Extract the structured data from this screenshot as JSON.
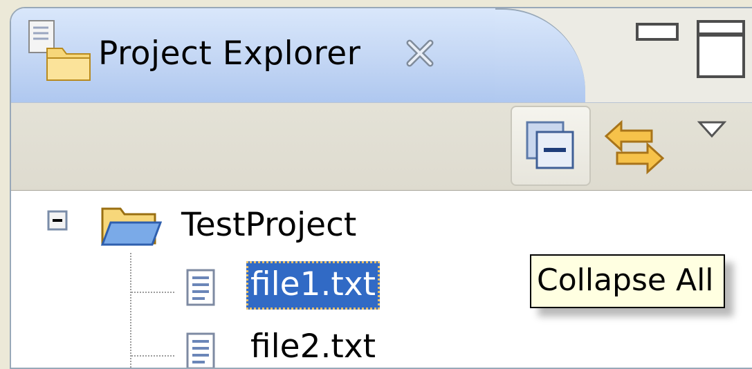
{
  "view": {
    "title": "Project Explorer",
    "icons": {
      "view": "project-explorer-icon",
      "close": "close-icon",
      "minimize": "minimize-icon",
      "maximize": "maximize-icon"
    }
  },
  "toolbar": {
    "buttons": [
      {
        "icon": "collapse-all-icon",
        "tooltip": "Collapse All"
      },
      {
        "icon": "link-with-editor-icon"
      },
      {
        "icon": "view-menu-icon"
      }
    ]
  },
  "tree": {
    "project": {
      "label": "TestProject",
      "expanded": true
    },
    "files": [
      {
        "label": "file1.txt",
        "selected": true
      },
      {
        "label": "file2.txt",
        "selected": false
      }
    ]
  },
  "tooltip": {
    "text": "Collapse All"
  },
  "colors": {
    "selection": "#316ac5",
    "tab_active": "#c3d6f4",
    "tooltip_bg": "#ffffe1"
  }
}
